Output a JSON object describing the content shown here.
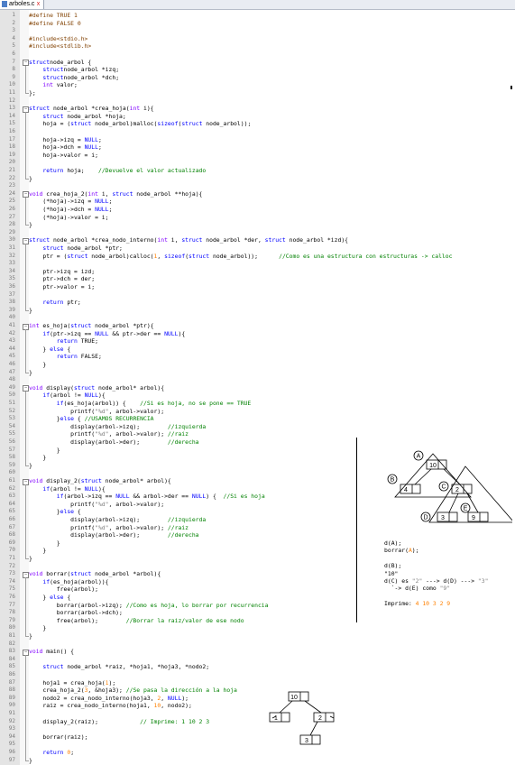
{
  "tab": {
    "filename": "arboles.c",
    "close_glyph": "x"
  },
  "code": [
    {
      "n": "1",
      "t": [
        [
          "pp",
          "#define TRUE 1"
        ]
      ]
    },
    {
      "n": "2",
      "t": [
        [
          "pp",
          "#define FALSE 0"
        ]
      ]
    },
    {
      "n": "3",
      "t": []
    },
    {
      "n": "4",
      "t": [
        [
          "pp",
          "#include<stdio.h>"
        ]
      ]
    },
    {
      "n": "5",
      "t": [
        [
          "pp",
          "#include<stdlib.h>"
        ]
      ]
    },
    {
      "n": "6",
      "t": []
    },
    {
      "n": "7",
      "t": [
        [
          "kw",
          "struct"
        ],
        [
          "",
          "node_arbol {"
        ]
      ]
    },
    {
      "n": "8",
      "t": [
        [
          "",
          "    "
        ],
        [
          "kw",
          "struct"
        ],
        [
          "",
          "node_arbol *izq;"
        ]
      ]
    },
    {
      "n": "9",
      "t": [
        [
          "",
          "    "
        ],
        [
          "kw",
          "struct"
        ],
        [
          "",
          "node_arbol *dch;"
        ]
      ]
    },
    {
      "n": "10",
      "t": [
        [
          "",
          "    "
        ],
        [
          "ty",
          "int"
        ],
        [
          "",
          " valor;"
        ]
      ]
    },
    {
      "n": "11",
      "t": [
        [
          "",
          "};"
        ]
      ]
    },
    {
      "n": "12",
      "t": []
    },
    {
      "n": "13",
      "t": [
        [
          "kw",
          "struct"
        ],
        [
          "",
          " node_arbol *crea_hoja("
        ],
        [
          "ty",
          "int"
        ],
        [
          "",
          " i){"
        ]
      ]
    },
    {
      "n": "14",
      "t": [
        [
          "",
          "    "
        ],
        [
          "kw",
          "struct"
        ],
        [
          "",
          " node_arbol *hoja;"
        ]
      ]
    },
    {
      "n": "15",
      "t": [
        [
          "",
          "    hoja = ("
        ],
        [
          "kw",
          "struct"
        ],
        [
          "",
          " node_arbol)malloc("
        ],
        [
          "kw",
          "sizeof"
        ],
        [
          "",
          "("
        ],
        [
          "kw",
          "struct"
        ],
        [
          "",
          " node_arbol));"
        ]
      ]
    },
    {
      "n": "16",
      "t": []
    },
    {
      "n": "17",
      "t": [
        [
          "",
          "    hoja->izq = "
        ],
        [
          "kw",
          "NULL"
        ],
        [
          "",
          ";"
        ]
      ]
    },
    {
      "n": "18",
      "t": [
        [
          "",
          "    hoja->dch = "
        ],
        [
          "kw",
          "NULL"
        ],
        [
          "",
          ";"
        ]
      ]
    },
    {
      "n": "19",
      "t": [
        [
          "",
          "    hoja->valor = i;"
        ]
      ]
    },
    {
      "n": "20",
      "t": []
    },
    {
      "n": "21",
      "t": [
        [
          "",
          "    "
        ],
        [
          "kw",
          "return"
        ],
        [
          "",
          " hoja;    "
        ],
        [
          "cm",
          "//Devuelve el valor actualizado"
        ]
      ]
    },
    {
      "n": "22",
      "t": [
        [
          "",
          "}"
        ]
      ]
    },
    {
      "n": "23",
      "t": []
    },
    {
      "n": "24",
      "t": [
        [
          "ty",
          "void"
        ],
        [
          "",
          " crea_hoja_2("
        ],
        [
          "ty",
          "int"
        ],
        [
          "",
          " i, "
        ],
        [
          "kw",
          "struct"
        ],
        [
          "",
          " node_arbol **hoja){"
        ]
      ]
    },
    {
      "n": "25",
      "t": [
        [
          "",
          "    (*hoja)->izq = "
        ],
        [
          "kw",
          "NULL"
        ],
        [
          "",
          ";"
        ]
      ]
    },
    {
      "n": "26",
      "t": [
        [
          "",
          "    (*hoja)->dch = "
        ],
        [
          "kw",
          "NULL"
        ],
        [
          "",
          ";"
        ]
      ]
    },
    {
      "n": "27",
      "t": [
        [
          "",
          "    (*hoja)->valor = i;"
        ]
      ]
    },
    {
      "n": "28",
      "t": [
        [
          "",
          "}"
        ]
      ]
    },
    {
      "n": "29",
      "t": []
    },
    {
      "n": "30",
      "t": [
        [
          "kw",
          "struct"
        ],
        [
          "",
          " node_arbol *crea_nodo_interno("
        ],
        [
          "ty",
          "int"
        ],
        [
          "",
          " i, "
        ],
        [
          "kw",
          "struct"
        ],
        [
          "",
          " node_arbol *der, "
        ],
        [
          "kw",
          "struct"
        ],
        [
          "",
          " node_arbol *izd){"
        ]
      ]
    },
    {
      "n": "31",
      "t": [
        [
          "",
          "    "
        ],
        [
          "kw",
          "struct"
        ],
        [
          "",
          " node_arbol *ptr;"
        ]
      ]
    },
    {
      "n": "32",
      "t": [
        [
          "",
          "    ptr = ("
        ],
        [
          "kw",
          "struct"
        ],
        [
          "",
          " node_arbol)calloc("
        ],
        [
          "nm",
          "1"
        ],
        [
          "",
          ", "
        ],
        [
          "kw",
          "sizeof"
        ],
        [
          "",
          "("
        ],
        [
          "kw",
          "struct"
        ],
        [
          "",
          " node_arbol));      "
        ],
        [
          "cm",
          "//Como es una estructura con estructuras -> calloc"
        ]
      ]
    },
    {
      "n": "33",
      "t": []
    },
    {
      "n": "34",
      "t": [
        [
          "",
          "    ptr->izq = izd;"
        ]
      ]
    },
    {
      "n": "35",
      "t": [
        [
          "",
          "    ptr->dch = der;"
        ]
      ]
    },
    {
      "n": "36",
      "t": [
        [
          "",
          "    ptr->valor = i;"
        ]
      ]
    },
    {
      "n": "37",
      "t": []
    },
    {
      "n": "38",
      "t": [
        [
          "",
          "    "
        ],
        [
          "kw",
          "return"
        ],
        [
          "",
          " ptr;"
        ]
      ]
    },
    {
      "n": "39",
      "t": [
        [
          "",
          "}"
        ]
      ]
    },
    {
      "n": "40",
      "t": []
    },
    {
      "n": "41",
      "t": [
        [
          "ty",
          "int"
        ],
        [
          "",
          " es_hoja("
        ],
        [
          "kw",
          "struct"
        ],
        [
          "",
          " node_arbol *ptr){"
        ]
      ]
    },
    {
      "n": "42",
      "t": [
        [
          "",
          "    "
        ],
        [
          "kw",
          "if"
        ],
        [
          "",
          "(ptr->izq == "
        ],
        [
          "kw",
          "NULL"
        ],
        [
          "",
          " && ptr->der == "
        ],
        [
          "kw",
          "NULL"
        ],
        [
          "",
          "){"
        ]
      ]
    },
    {
      "n": "43",
      "t": [
        [
          "",
          "        "
        ],
        [
          "kw",
          "return"
        ],
        [
          "",
          " TRUE;"
        ]
      ]
    },
    {
      "n": "44",
      "t": [
        [
          "",
          "    } "
        ],
        [
          "kw",
          "else"
        ],
        [
          "",
          " {"
        ]
      ]
    },
    {
      "n": "45",
      "t": [
        [
          "",
          "        "
        ],
        [
          "kw",
          "return"
        ],
        [
          "",
          " FALSE;"
        ]
      ]
    },
    {
      "n": "46",
      "t": [
        [
          "",
          "    }"
        ]
      ]
    },
    {
      "n": "47",
      "t": [
        [
          "",
          "}"
        ]
      ]
    },
    {
      "n": "48",
      "t": []
    },
    {
      "n": "49",
      "t": [
        [
          "ty",
          "void"
        ],
        [
          "",
          " display("
        ],
        [
          "kw",
          "struct"
        ],
        [
          "",
          " node_arbol* arbol){"
        ]
      ]
    },
    {
      "n": "50",
      "t": [
        [
          "",
          "    "
        ],
        [
          "kw",
          "if"
        ],
        [
          "",
          "(arbol != "
        ],
        [
          "kw",
          "NULL"
        ],
        [
          "",
          "){"
        ]
      ]
    },
    {
      "n": "51",
      "t": [
        [
          "",
          "        "
        ],
        [
          "kw",
          "if"
        ],
        [
          "",
          "(es_hoja(arbol)) {    "
        ],
        [
          "cm",
          "//Si es hoja, no se pone == TRUE"
        ]
      ]
    },
    {
      "n": "52",
      "t": [
        [
          "",
          "            printf("
        ],
        [
          "st",
          "\"%d\""
        ],
        [
          "",
          ", arbol->valor);"
        ]
      ]
    },
    {
      "n": "53",
      "t": [
        [
          "",
          "        }"
        ],
        [
          "kw",
          "else"
        ],
        [
          "",
          " { "
        ],
        [
          "cm",
          "//USAMOS RECURRENCIA"
        ]
      ]
    },
    {
      "n": "54",
      "t": [
        [
          "",
          "            display(arbol->izq);        "
        ],
        [
          "cm",
          "//izquierda"
        ]
      ]
    },
    {
      "n": "55",
      "t": [
        [
          "",
          "            printf("
        ],
        [
          "st",
          "\"%d\""
        ],
        [
          "",
          ", arbol->valor); "
        ],
        [
          "cm",
          "//raiz"
        ]
      ]
    },
    {
      "n": "56",
      "t": [
        [
          "",
          "            display(arbol->der);        "
        ],
        [
          "cm",
          "//derecha"
        ]
      ]
    },
    {
      "n": "57",
      "t": [
        [
          "",
          "        }"
        ]
      ]
    },
    {
      "n": "58",
      "t": [
        [
          "",
          "    }"
        ]
      ]
    },
    {
      "n": "59",
      "t": [
        [
          "",
          "}"
        ]
      ]
    },
    {
      "n": "60",
      "t": []
    },
    {
      "n": "61",
      "t": [
        [
          "ty",
          "void"
        ],
        [
          "",
          " display_2("
        ],
        [
          "kw",
          "struct"
        ],
        [
          "",
          " node_arbol* arbol){"
        ]
      ]
    },
    {
      "n": "62",
      "t": [
        [
          "",
          "    "
        ],
        [
          "kw",
          "if"
        ],
        [
          "",
          "(arbol != "
        ],
        [
          "kw",
          "NULL"
        ],
        [
          "",
          "){"
        ]
      ]
    },
    {
      "n": "63",
      "t": [
        [
          "",
          "        "
        ],
        [
          "kw",
          "if"
        ],
        [
          "",
          "(arbol->izq == "
        ],
        [
          "kw",
          "NULL"
        ],
        [
          "",
          " && arbol->der == "
        ],
        [
          "kw",
          "NULL"
        ],
        [
          "",
          ") {  "
        ],
        [
          "cm",
          "//Si es hoja"
        ]
      ]
    },
    {
      "n": "64",
      "t": [
        [
          "",
          "            printf("
        ],
        [
          "st",
          "\"%d\""
        ],
        [
          "",
          ", arbol->valor);"
        ]
      ]
    },
    {
      "n": "65",
      "t": [
        [
          "",
          "        }"
        ],
        [
          "kw",
          "else"
        ],
        [
          "",
          " {"
        ]
      ]
    },
    {
      "n": "66",
      "t": [
        [
          "",
          "            display(arbol->izq);        "
        ],
        [
          "cm",
          "//izquierda"
        ]
      ]
    },
    {
      "n": "67",
      "t": [
        [
          "",
          "            printf("
        ],
        [
          "st",
          "\"%d\""
        ],
        [
          "",
          ", arbol->valor); "
        ],
        [
          "cm",
          "//raiz"
        ]
      ]
    },
    {
      "n": "68",
      "t": [
        [
          "",
          "            display(arbol->der);        "
        ],
        [
          "cm",
          "//derecha"
        ]
      ]
    },
    {
      "n": "69",
      "t": [
        [
          "",
          "        }"
        ]
      ]
    },
    {
      "n": "70",
      "t": [
        [
          "",
          "    }"
        ]
      ]
    },
    {
      "n": "71",
      "t": [
        [
          "",
          "}"
        ]
      ]
    },
    {
      "n": "72",
      "t": []
    },
    {
      "n": "73",
      "t": [
        [
          "ty",
          "void"
        ],
        [
          "",
          " borrar("
        ],
        [
          "kw",
          "struct"
        ],
        [
          "",
          " node_arbol *arbol){"
        ]
      ]
    },
    {
      "n": "74",
      "t": [
        [
          "",
          "    "
        ],
        [
          "kw",
          "if"
        ],
        [
          "",
          "(es_hoja(arbol)){"
        ]
      ]
    },
    {
      "n": "75",
      "t": [
        [
          "",
          "        free(arbol);"
        ]
      ]
    },
    {
      "n": "76",
      "t": [
        [
          "",
          "    } "
        ],
        [
          "kw",
          "else"
        ],
        [
          "",
          " {"
        ]
      ]
    },
    {
      "n": "77",
      "t": [
        [
          "",
          "        borrar(arbol->izq); "
        ],
        [
          "cm",
          "//Como es hoja, lo borrar por recurrencia"
        ]
      ]
    },
    {
      "n": "78",
      "t": [
        [
          "",
          "        borrar(arbol->dch);"
        ]
      ]
    },
    {
      "n": "79",
      "t": [
        [
          "",
          "        free(arbol);        "
        ],
        [
          "cm",
          "//Borrar la raiz/valor de ese nodo"
        ]
      ]
    },
    {
      "n": "80",
      "t": [
        [
          "",
          "    }"
        ]
      ]
    },
    {
      "n": "81",
      "t": [
        [
          "",
          "}"
        ]
      ]
    },
    {
      "n": "82",
      "t": []
    },
    {
      "n": "83",
      "t": [
        [
          "ty",
          "void"
        ],
        [
          "",
          " main() {"
        ]
      ]
    },
    {
      "n": "84",
      "t": []
    },
    {
      "n": "85",
      "t": [
        [
          "",
          "    "
        ],
        [
          "kw",
          "struct"
        ],
        [
          "",
          " node_arbol *raiz, *hoja1, *hoja3, *nodo2;"
        ]
      ]
    },
    {
      "n": "86",
      "t": []
    },
    {
      "n": "87",
      "t": [
        [
          "",
          "    hoja1 = crea_hoja("
        ],
        [
          "nm",
          "1"
        ],
        [
          "",
          ");"
        ]
      ]
    },
    {
      "n": "88",
      "t": [
        [
          "",
          "    crea_hoja_2("
        ],
        [
          "nm",
          "3"
        ],
        [
          "",
          ", &hoja3); "
        ],
        [
          "cm",
          "//Se pasa la dirección a la hoja"
        ]
      ]
    },
    {
      "n": "89",
      "t": [
        [
          "",
          "    nodo2 = crea_nodo_interno(hoja3, "
        ],
        [
          "nm",
          "2"
        ],
        [
          "",
          ", "
        ],
        [
          "kw",
          "NULL"
        ],
        [
          "",
          ");"
        ]
      ]
    },
    {
      "n": "90",
      "t": [
        [
          "",
          "    raiz = crea_nodo_interno(hoja1, "
        ],
        [
          "nm",
          "10"
        ],
        [
          "",
          ", nodo2);"
        ]
      ]
    },
    {
      "n": "91",
      "t": []
    },
    {
      "n": "92",
      "t": [
        [
          "",
          "    display_2(raiz);            "
        ],
        [
          "cm",
          "// Imprime: 1 10 2 3"
        ]
      ]
    },
    {
      "n": "93",
      "t": []
    },
    {
      "n": "94",
      "t": [
        [
          "",
          "    borrar(raiz);"
        ]
      ]
    },
    {
      "n": "95",
      "t": []
    },
    {
      "n": "96",
      "t": [
        [
          "",
          "    "
        ],
        [
          "kw",
          "return"
        ],
        [
          "",
          " "
        ],
        [
          "nm",
          "0"
        ],
        [
          "",
          ";"
        ]
      ]
    },
    {
      "n": "97",
      "t": [
        [
          "",
          "}"
        ]
      ]
    }
  ],
  "annotations": {
    "line1": "d(A);",
    "line2_pre": "borrar(",
    "line2_num": "A",
    "line2_post": ");",
    "line3": "d(B);",
    "line4": "\"10\"",
    "line5_a": "d(C) es ",
    "line5_b": "\"2\"",
    "line5_c": " ---> d(D) ---> ",
    "line5_d": "\"3\"",
    "line6_a": "  `-> d(E) como ",
    "line6_b": "\"9\"",
    "line7_label": "Imprime: ",
    "line7_values": "4 10 3 2 9"
  },
  "tree1": {
    "labels": {
      "A": "A",
      "B": "B",
      "C": "C",
      "D": "D",
      "E": "E"
    },
    "values": {
      "root": "10",
      "b": "4",
      "c": "2",
      "d": "3",
      "e": "9"
    }
  },
  "tree2": {
    "values": {
      "root": "10",
      "left": "1",
      "right": "2",
      "leaf": "3"
    }
  },
  "colors": {
    "preprocessor": "#804000",
    "keyword": "#0000ff",
    "type": "#8000ff",
    "comment": "#008000",
    "number": "#ff8000",
    "string": "#808080"
  }
}
